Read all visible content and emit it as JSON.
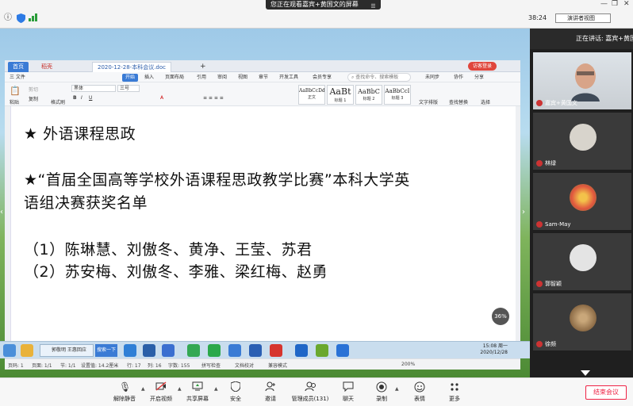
{
  "topbar": {
    "watching_text": "您正在观看嘉宾+黄国文的屏幕",
    "timer": "38:24",
    "speaker_view_label": "演讲者视图"
  },
  "wps": {
    "tabs": {
      "home": "首页",
      "docer": "稻壳",
      "document": "2020-12-28-本科会议.doc",
      "new_tab": "+"
    },
    "login_label": "访客登录",
    "menu": {
      "file": "三 文件",
      "start": "开始",
      "insert": "插入",
      "layout": "页面布局",
      "references": "引用",
      "review": "审阅",
      "view": "视图",
      "section": "章节",
      "devtools": "开发工具",
      "member": "会员专享",
      "search_placeholder": "查找命令、搜索模板",
      "unsynced": "未同步",
      "collab": "协作",
      "share": "分享"
    },
    "ribbon": {
      "paste": "粘贴",
      "cut": "剪切",
      "copy": "复制",
      "format_painter": "格式刷",
      "font_name": "黑体",
      "font_size": "三号",
      "styles": [
        {
          "sample": "AaBbCcDd",
          "name": "正文"
        },
        {
          "sample": "AaBt",
          "name": "标题 1"
        },
        {
          "sample": "AaBbC",
          "name": "标题 2"
        },
        {
          "sample": "AaBbCcI",
          "name": "标题 3"
        }
      ],
      "text_layout": "文字排版",
      "find_replace": "查找替换",
      "select": "选择"
    },
    "document": {
      "line1": "★ 外语课程思政",
      "line2": "★“首届全国高等学校外语课程思政教学比赛”本科大学英",
      "line3": "语组决赛获奖名单",
      "line4": "（1）陈琳慧、刘傲冬、黄净、王莹、苏君",
      "line5": "（2）苏安梅、刘傲冬、李雅、梁红梅、赵勇"
    },
    "status": {
      "page": "页码: 1",
      "pages": "页面: 1/1",
      "section": "节: 1/1",
      "setting": "设置值: 14.2厘米",
      "row": "行: 17",
      "col": "列: 16",
      "words": "字数: 155",
      "spell": "拼写检查",
      "proof": "文档校对",
      "compat": "兼容模式",
      "zoom": "200%"
    },
    "zoom_bubble": "36%"
  },
  "taskbar": {
    "window_label": "郭敬明 王惠回应",
    "search_label": "搜索一下",
    "time": "15:08 周一",
    "date": "2020/12/28"
  },
  "panel": {
    "speaking": "正在讲话: 嘉宾+黄国文",
    "participants": [
      {
        "name": "嘉宾+黄国文"
      },
      {
        "name": "林绿"
      },
      {
        "name": "Sam-May"
      },
      {
        "name": "郭智颖"
      },
      {
        "name": "徐频"
      }
    ]
  },
  "controls": {
    "mute": "解除静音",
    "video": "开启视频",
    "share": "共享屏幕",
    "security": "安全",
    "invite": "邀请",
    "members": "管理成员(131)",
    "chat": "聊天",
    "record": "录制",
    "reactions": "表情",
    "more": "更多",
    "end": "结束会议"
  },
  "colors": {
    "wps_blue": "#3a7bd5",
    "end_red": "#ee2244",
    "panel_bg": "#1f1f1f"
  }
}
